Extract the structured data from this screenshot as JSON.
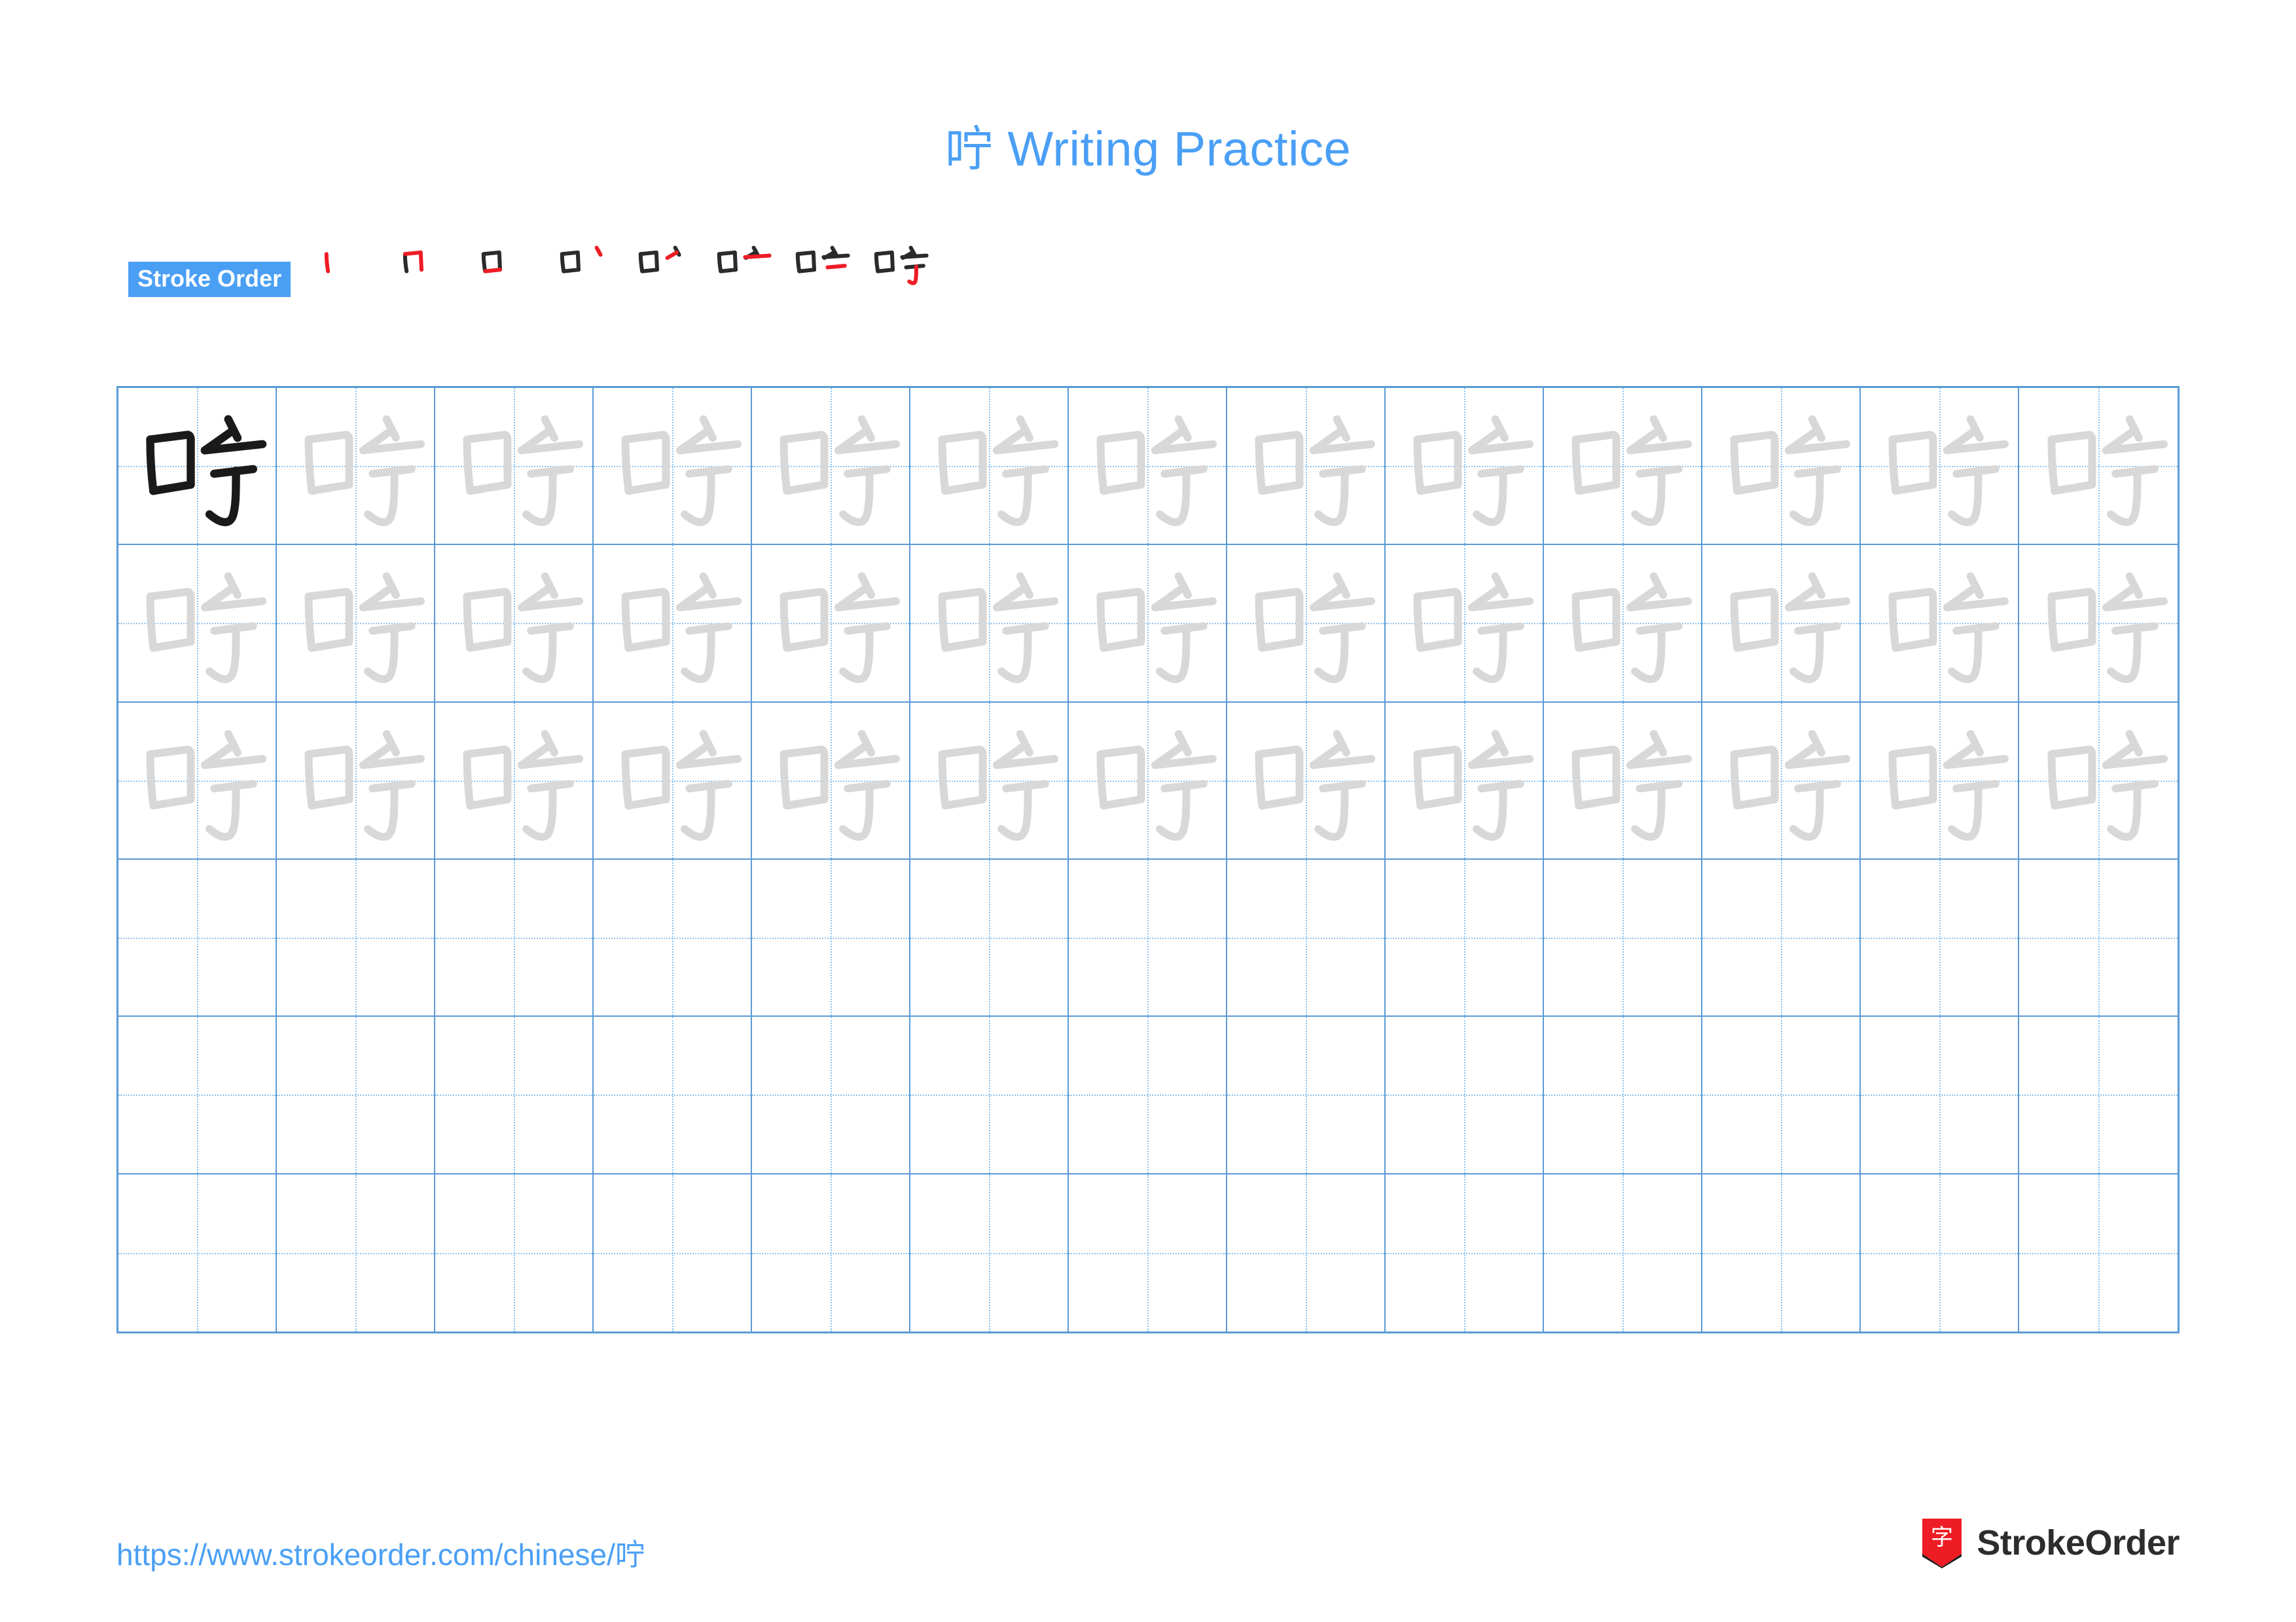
{
  "page": {
    "title": "咛 Writing Practice",
    "character": "咛"
  },
  "stroke_order": {
    "label": "Stroke Order",
    "steps": [
      {
        "index": 1,
        "name": "stroke-step-1"
      },
      {
        "index": 2,
        "name": "stroke-step-2"
      },
      {
        "index": 3,
        "name": "stroke-step-3"
      },
      {
        "index": 4,
        "name": "stroke-step-4"
      },
      {
        "index": 5,
        "name": "stroke-step-5"
      },
      {
        "index": 6,
        "name": "stroke-step-6"
      },
      {
        "index": 7,
        "name": "stroke-step-7"
      },
      {
        "index": 8,
        "name": "stroke-step-8"
      }
    ],
    "total_strokes": 8
  },
  "practice_grid": {
    "columns": 13,
    "rows": 6,
    "filled_rows": 3,
    "first_cell_style": "solid-black",
    "trace_cell_style": "light-gray",
    "empty_rows": 3
  },
  "footer": {
    "url": "https://www.strokeorder.com/chinese/咛",
    "brand_name": "StrokeOrder",
    "brand_logo_char": "字"
  },
  "colors": {
    "accent": "#4a9ff5",
    "grid_line": "#5b9bd5",
    "grid_dotted": "#8fc3ee",
    "stroke_highlight": "#ee1c25",
    "stroke_done": "#2b2b2b",
    "trace_gray": "#d8d8d8",
    "solid_black": "#1a1a1a",
    "brand_text": "#2d2d2d"
  }
}
